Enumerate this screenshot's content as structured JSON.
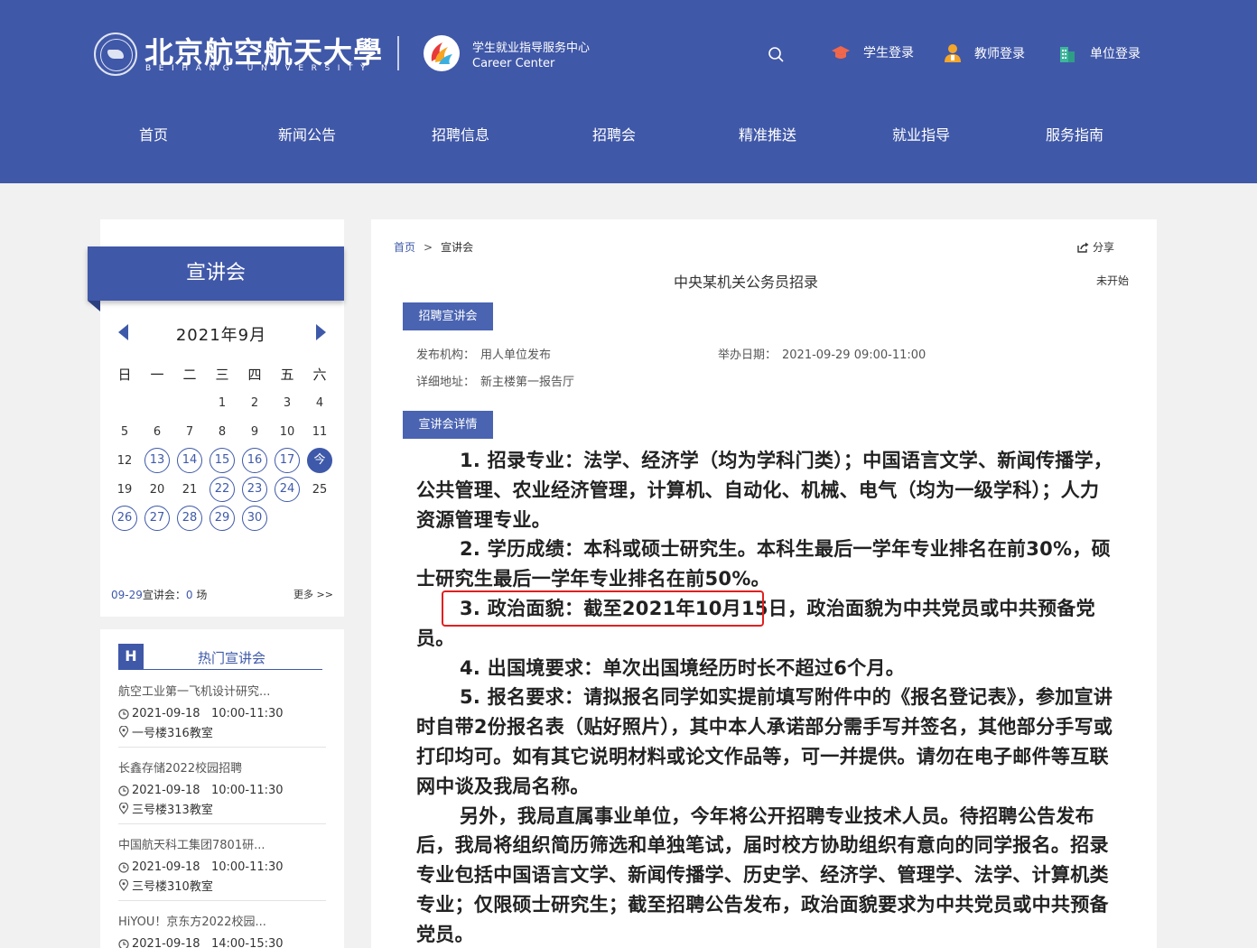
{
  "header": {
    "university_cn": "北京航空航天大學",
    "university_en": "BEIHANG UNIVERSITY",
    "center_cn": "学生就业指导服务中心",
    "center_en": "Career Center",
    "icons": [
      "search-icon",
      "graduation-cap-icon",
      "teacher-icon",
      "building-icon"
    ],
    "logins": {
      "student": "学生登录",
      "teacher": "教师登录",
      "unit": "单位登录"
    },
    "colors": {
      "primary": "#4058a8",
      "student_icon": "#f0674b",
      "teacher_icon": "#f4a62a",
      "unit_icon": "#3bb79b"
    }
  },
  "nav": [
    "首页",
    "新闻公告",
    "招聘信息",
    "招聘会",
    "精准推送",
    "就业指导",
    "服务指南"
  ],
  "calendar": {
    "banner": "宣讲会",
    "month": "2021年9月",
    "weekdays": [
      "日",
      "一",
      "二",
      "三",
      "四",
      "五",
      "六"
    ],
    "weeks": [
      [
        "",
        "",
        "",
        "1",
        "2",
        "3",
        "4"
      ],
      [
        "5",
        "6",
        "7",
        "8",
        "9",
        "10",
        "11"
      ],
      [
        "12",
        "13",
        "14",
        "15",
        "16",
        "17",
        "今"
      ],
      [
        "19",
        "20",
        "21",
        "22",
        "23",
        "24",
        "25"
      ],
      [
        "26",
        "27",
        "28",
        "29",
        "30",
        "",
        ""
      ]
    ],
    "circled": [
      "13",
      "14",
      "15",
      "16",
      "17",
      "22",
      "23",
      "24",
      "26",
      "27",
      "28",
      "29",
      "30"
    ],
    "today": "今",
    "footer_date": "09-29",
    "footer_label": "宣讲会：",
    "footer_count": "0",
    "footer_unit": "场",
    "more": "更多 >>"
  },
  "hot": {
    "badge": "H",
    "title": "热门宣讲会",
    "items": [
      {
        "title": "航空工业第一飞机设计研究...",
        "time": "2021-09-18   10:00-11:30",
        "place": "一号楼316教室"
      },
      {
        "title": "长鑫存储2022校园招聘",
        "time": "2021-09-18   10:00-11:30",
        "place": "三号楼313教室"
      },
      {
        "title": "中国航天科工集团7801研...",
        "time": "2021-09-18   10:00-11:30",
        "place": "三号楼310教室"
      },
      {
        "title": "HiYOU！京东方2022校园...",
        "time": "2021-09-18   14:00-15:30",
        "place": ""
      }
    ]
  },
  "detail": {
    "breadcrumb": {
      "home": "首页",
      "arrow": ">",
      "current": "宣讲会"
    },
    "share": "分享",
    "title": "中央某机关公务员招录",
    "status": "未开始",
    "tag_info": "招聘宣讲会",
    "publisher_label": "发布机构：",
    "publisher": "用人单位发布",
    "date_label": "举办日期：",
    "date": "2021-09-29   09:00-11:00",
    "address_label": "详细地址：",
    "address": "新主楼第一报告厅",
    "tag_detail": "宣讲会详情",
    "paragraphs": [
      "1. 招录专业：法学、经济学（均为学科门类）；中国语言文学、新闻传播学，公共管理、农业经济管理，计算机、自动化、机械、电气（均为一级学科）；人力资源管理专业。",
      "2. 学历成绩：本科或硕士研究生。本科生最后一学年专业排名在前30%，硕士研究生最后一学年专业排名在前50%。",
      "3. 政治面貌：截至2021年10月15日，政治面貌为中共党员或中共预备党员。",
      "4. 出国境要求：单次出国境经历时长不超过6个月。",
      "5. 报名要求：请拟报名同学如实提前填写附件中的《报名登记表》，参加宣讲时自带2份报名表（贴好照片），其中本人承诺部分需手写并签名，其他部分手写或打印均可。如有其它说明材料或论文作品等，可一并提供。请勿在电子邮件等互联网中谈及我局名称。",
      "另外，我局直属事业单位，今年将公开招聘专业技术人员。待招聘公告发布后，我局将组织简历筛选和单独笔试，届时校方协助组织有意向的同学报名。招录专业包括中国语言文学、新闻传播学、历史学、经济学、管理学、法学、计算机类专业；仅限硕士研究生；截至招聘公告发布，政治面貌要求为中共党员或中共预备党员。"
    ],
    "highlight_color": "#e02020"
  }
}
